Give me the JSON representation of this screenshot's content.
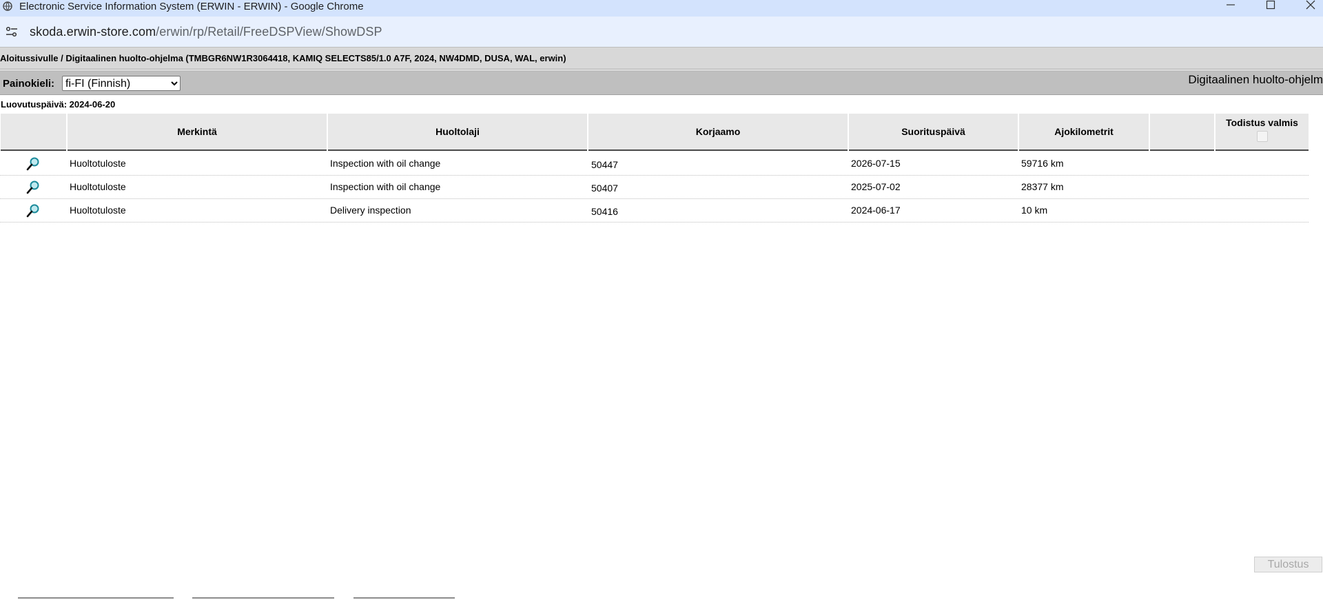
{
  "window": {
    "title": "Electronic Service Information System (ERWIN - ERWIN) - Google Chrome"
  },
  "address": {
    "domain": "skoda.erwin-store.com",
    "path": "/erwin/rp/Retail/FreeDSPView/ShowDSP"
  },
  "breadcrumb": "Aloitussivulle / Digitaalinen huolto-ohjelma (TMBGR6NW1R3064418, KAMIQ SELECTS85/1.0 A7F, 2024, NW4DMD, DUSA, WAL, erwin)",
  "language": {
    "label": "Painokieli:",
    "selected": "fi-FI (Finnish)"
  },
  "right_title": "Digitaalinen huolto-ohjelm",
  "delivery_date": "Luovutuspäivä: 2024-06-20",
  "table": {
    "headers": {
      "merkinta": "Merkintä",
      "huoltolaji": "Huoltolaji",
      "korjaamo": "Korjaamo",
      "suorituspaiva": "Suorituspäivä",
      "ajokilometrit": "Ajokilometrit",
      "todistus": "Todistus valmis"
    },
    "rows": [
      {
        "merkinta": "Huoltotuloste",
        "huoltolaji": "Inspection with oil change",
        "korjaamo": "50447",
        "suorituspaiva": "2026-07-15",
        "ajokilometrit": "59716 km"
      },
      {
        "merkinta": "Huoltotuloste",
        "huoltolaji": "Inspection with oil change",
        "korjaamo": "50407",
        "suorituspaiva": "2025-07-02",
        "ajokilometrit": "28377 km"
      },
      {
        "merkinta": "Huoltotuloste",
        "huoltolaji": "Delivery inspection",
        "korjaamo": "50416",
        "suorituspaiva": "2024-06-17",
        "ajokilometrit": "10 km"
      }
    ]
  },
  "print_button": "Tulostus",
  "icons": {
    "globe": "globe-icon",
    "minimize": "minimize-icon",
    "maximize": "maximize-icon",
    "close": "close-icon",
    "site_settings": "tune-icon",
    "view": "magnifier-icon"
  },
  "colors": {
    "titlebar": "#d3e3fd",
    "addressbar": "#e8f0fe",
    "breadcrumb_bg": "#d8d8d8",
    "langbar_bg": "#bfbfbf",
    "header_bg": "#e8e8e8",
    "magnifier": "#1a8a9a"
  }
}
